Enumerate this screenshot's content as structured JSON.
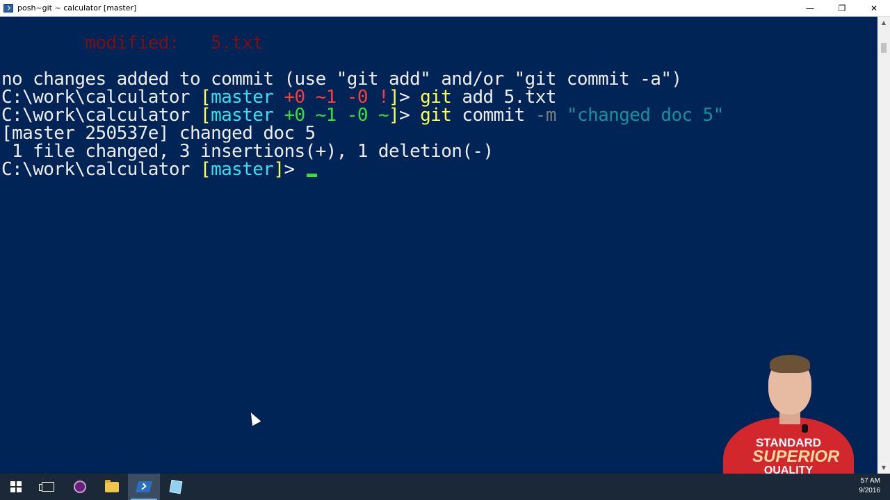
{
  "window": {
    "title": "posh~git ~ calculator [master]",
    "minimize_glyph": "—",
    "restore_glyph": "❐",
    "close_glyph": "✕"
  },
  "console": {
    "lines": [
      {
        "segments": [
          {
            "text": "        modified:   5.txt",
            "color": "#7a0f14"
          }
        ]
      },
      {
        "segments": [
          {
            "text": "no changes added to commit (use \"git add\" and/or \"git commit -a\")",
            "color": "#eeeded"
          }
        ]
      },
      {
        "segments": [
          {
            "text": "C:\\work\\calculator ",
            "color": "#eeeded"
          },
          {
            "text": "[",
            "color": "#ffff55"
          },
          {
            "text": "master",
            "color": "#37e0e6"
          },
          {
            "text": " +0 ~1 -0 !",
            "color": "#ff3b3b"
          },
          {
            "text": "]",
            "color": "#ffff55"
          },
          {
            "text": "> ",
            "color": "#eeeded"
          },
          {
            "text": "git",
            "color": "#ffff55"
          },
          {
            "text": " add 5.txt",
            "color": "#eeeded"
          }
        ]
      },
      {
        "segments": [
          {
            "text": "C:\\work\\calculator ",
            "color": "#eeeded"
          },
          {
            "text": "[",
            "color": "#ffff55"
          },
          {
            "text": "master",
            "color": "#37e0e6"
          },
          {
            "text": " +0 ~1 -0 ~",
            "color": "#36e036"
          },
          {
            "text": "]",
            "color": "#ffff55"
          },
          {
            "text": "> ",
            "color": "#eeeded"
          },
          {
            "text": "git",
            "color": "#ffff55"
          },
          {
            "text": " commit ",
            "color": "#eeeded"
          },
          {
            "text": "-m",
            "color": "#7b7b7b"
          },
          {
            "text": " \"changed doc 5\"",
            "color": "#14919a"
          }
        ]
      },
      {
        "segments": [
          {
            "text": "[master 250537e] changed doc 5",
            "color": "#eeeded"
          }
        ]
      },
      {
        "segments": [
          {
            "text": " 1 file changed, 3 insertions(+), 1 deletion(-)",
            "color": "#eeeded"
          }
        ]
      },
      {
        "segments": [
          {
            "text": "C:\\work\\calculator ",
            "color": "#eeeded"
          },
          {
            "text": "[",
            "color": "#ffff55"
          },
          {
            "text": "master",
            "color": "#37e0e6"
          },
          {
            "text": "]",
            "color": "#ffff55"
          },
          {
            "text": "> ",
            "color": "#eeeded"
          }
        ],
        "cursor": true
      }
    ]
  },
  "scrollbar": {
    "up_glyph": "▲",
    "down_glyph": "▼"
  },
  "presenter_shirt": {
    "line1": "STANDARD",
    "line2": "SUPERIOR",
    "line3": "QUALITY"
  },
  "taskbar": {
    "items": [
      "start-icon",
      "task-view-icon",
      "visual-studio-icon",
      "file-explorer-icon",
      "powershell-icon",
      "notepad-icon"
    ],
    "clock_time": "57 AM",
    "clock_date": "9/2016"
  },
  "colors": {
    "console_background": "#012456",
    "taskbar_background": "#1b2838"
  }
}
